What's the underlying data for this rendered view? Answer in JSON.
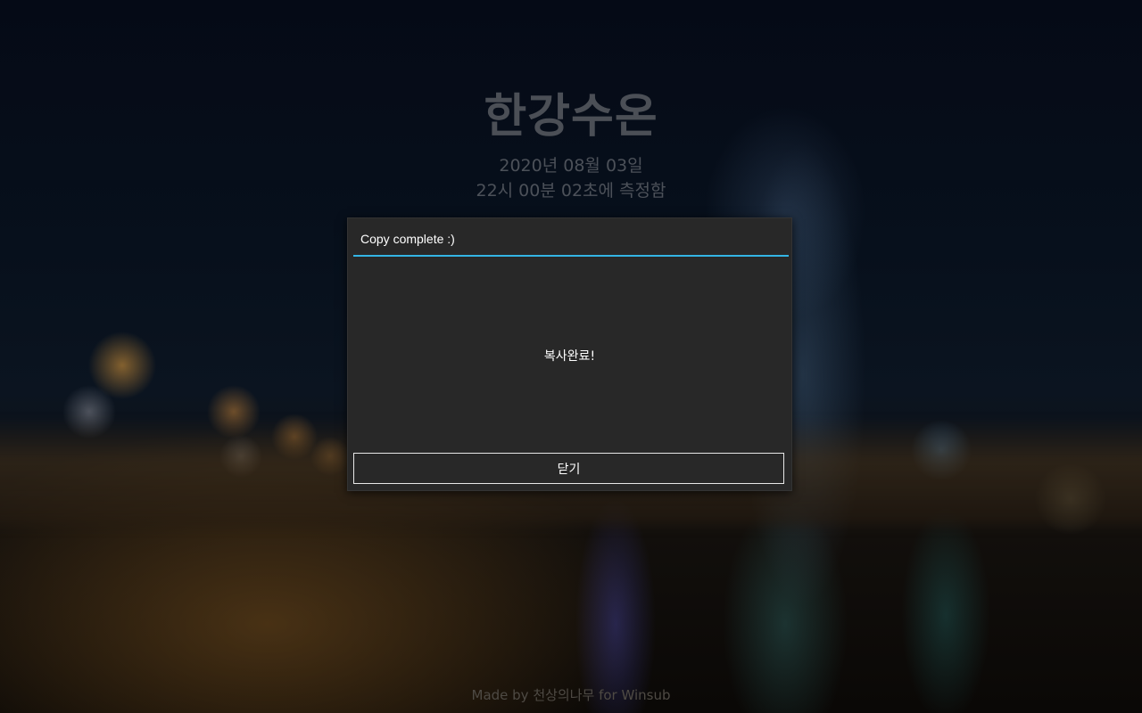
{
  "page": {
    "title": "한강수온",
    "date_line": "2020년 08월 03일",
    "time_line": "22시 00분 02초에 측정함",
    "footer": "Made by 천상의나무 for Winsub"
  },
  "dialog": {
    "title": "Copy complete :)",
    "message": "복사완료!",
    "close_label": "닫기",
    "accent_color": "#33b5e5",
    "background_color": "#282828"
  }
}
